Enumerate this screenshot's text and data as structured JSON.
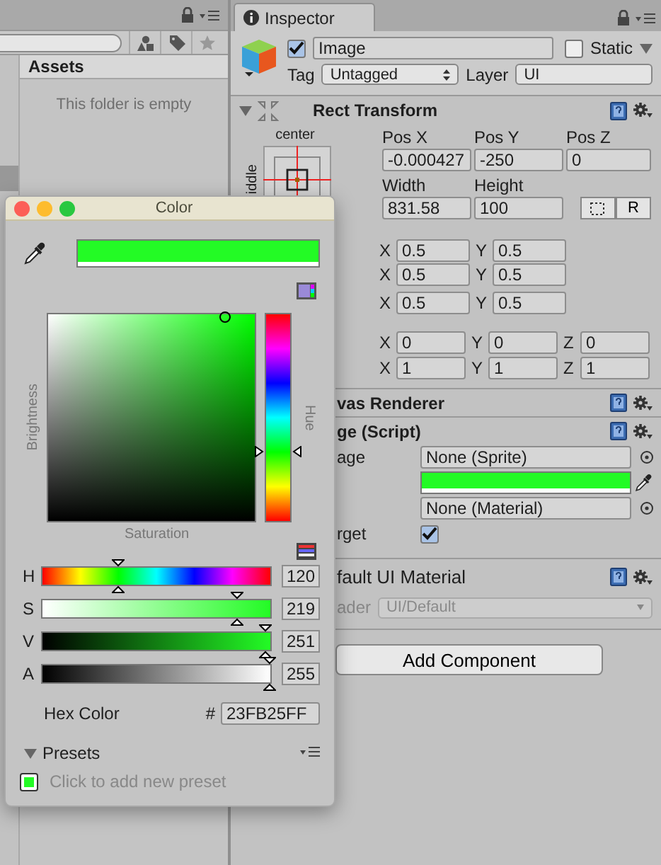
{
  "project_panel": {
    "assets_header": "Assets",
    "empty_message": "This folder is empty"
  },
  "inspector": {
    "tab": "Inspector",
    "object": {
      "enabled": true,
      "name": "Image",
      "static_label": "Static",
      "static": false,
      "tag_label": "Tag",
      "tag": "Untagged",
      "layer_label": "Layer",
      "layer": "UI"
    },
    "rect_transform": {
      "title": "Rect Transform",
      "expanded": true,
      "anchor_label": "center",
      "anchor_side_label": "iddle",
      "position_labels": [
        "Pos X",
        "Pos Y",
        "Pos Z"
      ],
      "position_values": [
        "-0.000427",
        "-250",
        "0"
      ],
      "size_labels": [
        "Width",
        "Height"
      ],
      "size_values": [
        "831.58",
        "100"
      ],
      "raw_button": "R",
      "vector_rows": [
        {
          "fields": [
            {
              "axis": "X",
              "value": "0.5"
            },
            {
              "axis": "Y",
              "value": "0.5"
            }
          ]
        },
        {
          "fields": [
            {
              "axis": "X",
              "value": "0.5"
            },
            {
              "axis": "Y",
              "value": "0.5"
            }
          ]
        },
        {
          "fields": [
            {
              "axis": "X",
              "value": "0.5"
            },
            {
              "axis": "Y",
              "value": "0.5"
            }
          ]
        },
        {
          "fields": [
            {
              "axis": "X",
              "value": "0"
            },
            {
              "axis": "Y",
              "value": "0"
            },
            {
              "axis": "Z",
              "value": "0"
            }
          ]
        },
        {
          "fields": [
            {
              "axis": "X",
              "value": "1"
            },
            {
              "axis": "Y",
              "value": "1"
            },
            {
              "axis": "Z",
              "value": "1"
            }
          ]
        }
      ]
    },
    "canvas_renderer": {
      "title": "vas Renderer"
    },
    "image_script": {
      "title": "ge (Script)",
      "rows": [
        {
          "kind": "object",
          "label": "age",
          "value": "None (Sprite)"
        },
        {
          "kind": "color",
          "color": "#23fb25"
        },
        {
          "kind": "object",
          "value": "None (Material)"
        },
        {
          "kind": "toggle",
          "label": "rget",
          "checked": true
        }
      ]
    },
    "material": {
      "title": "fault UI Material",
      "shader_label": "ader",
      "shader": "UI/Default",
      "disabled": true
    },
    "add_component": "Add Component"
  },
  "color_window": {
    "title": "Color",
    "color": "#23fb25",
    "hue": {
      "level": 0.333
    },
    "brightness_label": "Brightness",
    "saturation_label": "Saturation",
    "hue_label": "Hue",
    "sliders": [
      {
        "kind": "hue",
        "label": "H",
        "value": "120",
        "level": 0.333
      },
      {
        "kind": "saturation",
        "label": "S",
        "value": "219",
        "level": 0.859
      },
      {
        "kind": "value",
        "label": "V",
        "value": "251",
        "level": 0.984
      },
      {
        "kind": "alpha",
        "label": "A",
        "value": "255",
        "level": 1
      }
    ],
    "hex_label": "Hex Color",
    "hash": "#",
    "hex": "23FB25FF",
    "presets_label": "Presets",
    "presets_expanded": true,
    "presets": [
      {
        "color": "#23fb25"
      }
    ],
    "preset_hint": "Click to add new preset"
  }
}
